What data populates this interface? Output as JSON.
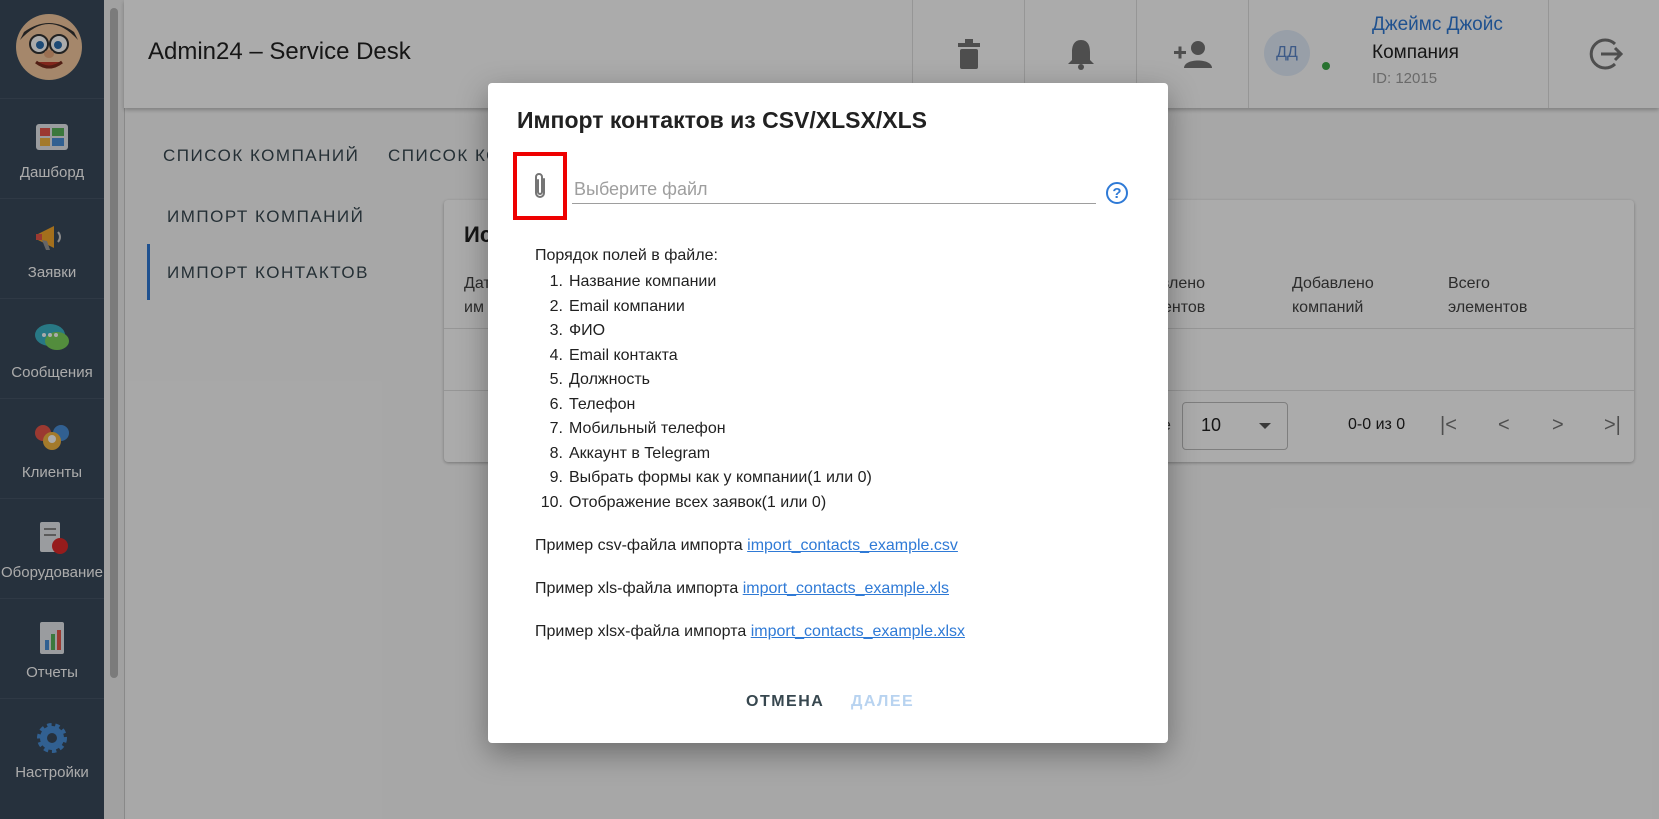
{
  "app": {
    "title": "Admin24 – Service Desk"
  },
  "sidebar": {
    "items": [
      {
        "label": "Дашборд",
        "icon": "dashboard-icon"
      },
      {
        "label": "Заявки",
        "icon": "megaphone-icon"
      },
      {
        "label": "Сообщения",
        "icon": "chat-icon"
      },
      {
        "label": "Клиенты",
        "icon": "clients-icon"
      },
      {
        "label": "Оборудование",
        "icon": "equipment-icon"
      },
      {
        "label": "Отчеты",
        "icon": "reports-icon"
      },
      {
        "label": "Настройки",
        "icon": "gear-icon"
      }
    ]
  },
  "header": {
    "user": {
      "initials": "ДД",
      "name": "Джеймс Джойс",
      "company": "Компания",
      "id": "ID: 12015"
    }
  },
  "page": {
    "tabs": [
      "СПИСОК КОМПАНИЙ",
      "СПИСОК КО"
    ],
    "side_nav": [
      "ИМПОРТ КОМПАНИЙ",
      "ИМПОРТ КОНТАКТОВ"
    ],
    "card": {
      "title": "Ис",
      "columns": [
        "Дат\nим",
        "овлено\nментов",
        "Добавлено\nкомпаний",
        "Всего\nэлементов"
      ],
      "partial_text": "и",
      "rows_per_page_fragment": "е",
      "rows_per_page": "10",
      "range": "0-0 из 0"
    }
  },
  "dialog": {
    "title": "Импорт контактов из CSV/XLSX/XLS",
    "file_placeholder": "Выберите файл",
    "help": "?",
    "field_order_title": "Порядок полей в файле:",
    "fields": [
      "Название компании",
      "Email компании",
      "ФИО",
      "Email контакта",
      "Должность",
      "Телефон",
      "Мобильный телефон",
      "Аккаунт в Telegram",
      "Выбрать формы как у компании(1 или 0)",
      "Отображение всех заявок(1 или 0)"
    ],
    "examples": [
      {
        "text": "Пример csv-файла импорта",
        "link": "import_contacts_example.csv"
      },
      {
        "text": "Пример xls-файла импорта",
        "link": "import_contacts_example.xls"
      },
      {
        "text": "Пример xlsx-файла импорта",
        "link": "import_contacts_example.xlsx"
      }
    ],
    "cancel_label": "ОТМЕНА",
    "next_label": "ДАЛЕЕ"
  },
  "colors": {
    "accent": "#2f7ad6",
    "sidebar": "#3a4a5c",
    "highlight": "#e00000"
  }
}
